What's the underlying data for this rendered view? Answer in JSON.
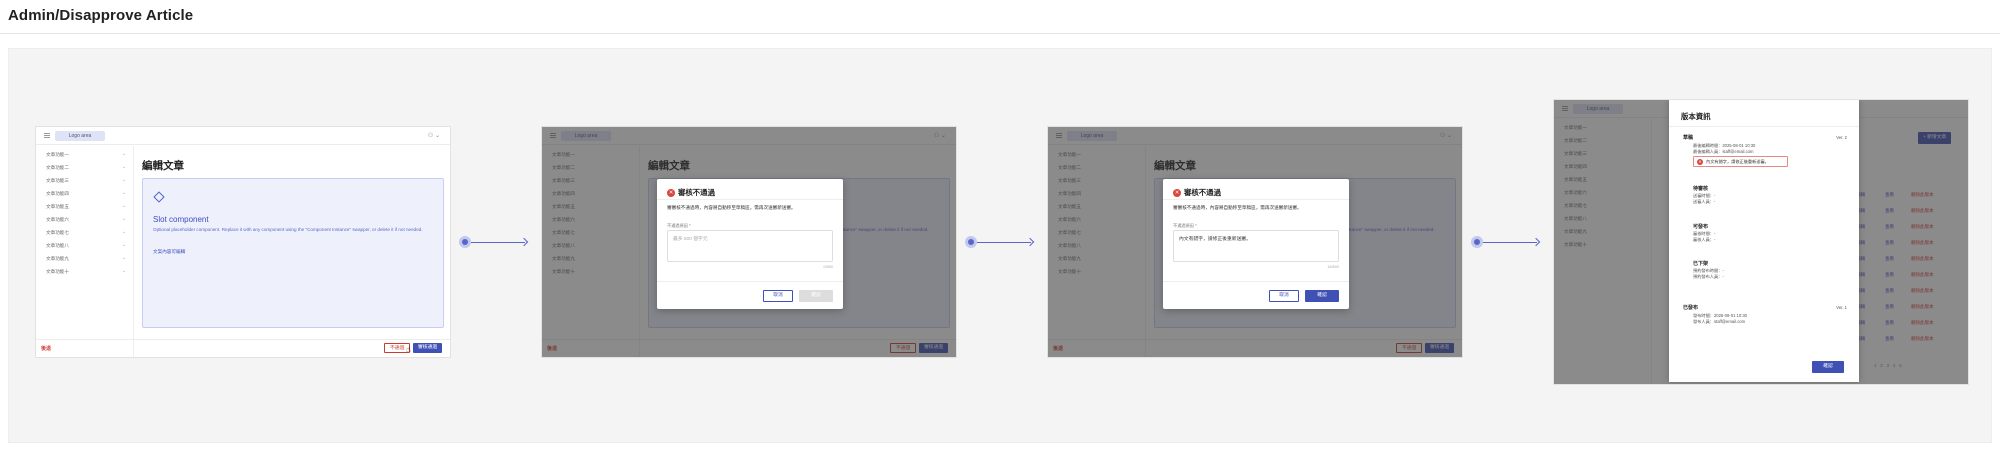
{
  "page_title": "Admin/Disapprove Article",
  "common": {
    "logo": "Logo area",
    "page_heading": "編輯文章",
    "sidebar_items": [
      "文章功能一",
      "文章功能二",
      "文章功能三",
      "文章功能四",
      "文章功能五",
      "文章功能六",
      "文章功能七",
      "文章功能八",
      "文章功能九",
      "文章功能十"
    ],
    "slot": {
      "title": "Slot component",
      "desc": "Optional placeholder component. Replace it with any component using the \"Component Instance\" swapper, or delete it if not needed.",
      "link": "文案內容可編輯"
    },
    "footer": {
      "back": "後退",
      "reject": "不通過",
      "approve": "審核通過"
    }
  },
  "modal": {
    "title": "審核不通過",
    "body": "審審核不通過時，內容將自動移至草稿區，需再次送審新送審。",
    "label": "不通過原因 *",
    "placeholder": "最多 500 個字元",
    "filled_value": "內文有錯字，請修正後重新送審。",
    "count_empty": "0/500",
    "count_filled": "16/500",
    "cancel": "取消",
    "confirm": "確認"
  },
  "version_panel": {
    "title": "版本資訊",
    "entries": [
      {
        "status": "草稿",
        "version": "Ver. 2",
        "time_label": "最後編輯時間：2025-08-01 10:30",
        "person_label": "最後編輯人員：staff@email.com",
        "reason": "內文有錯字，請修正後重新送審。"
      },
      {
        "status": "待審核",
        "time_label": "送審時間：-",
        "person_label": "送審人員：-"
      },
      {
        "status": "可發布",
        "time_label": "審核時間：-",
        "person_label": "審核人員：-"
      },
      {
        "status": "已下架",
        "time_label": "預約發布時間：-",
        "person_label": "預約發布人員：-"
      },
      {
        "status": "已發布",
        "version": "Ver. 1",
        "time_label": "發布時間：2025-08-01 10:30",
        "person_label": "發布人員：staff@email.com"
      }
    ],
    "confirm": "確認",
    "add_button": "+ 新增文章",
    "table_actions": {
      "edit": "編輯",
      "view": "查看",
      "delete": "刪除此版本"
    },
    "pager": [
      "1",
      "2",
      "3",
      "4",
      "5"
    ]
  },
  "colors": {
    "primary": "#3f51b5",
    "danger": "#d03a2c",
    "slot_bg": "#eef0fc"
  }
}
